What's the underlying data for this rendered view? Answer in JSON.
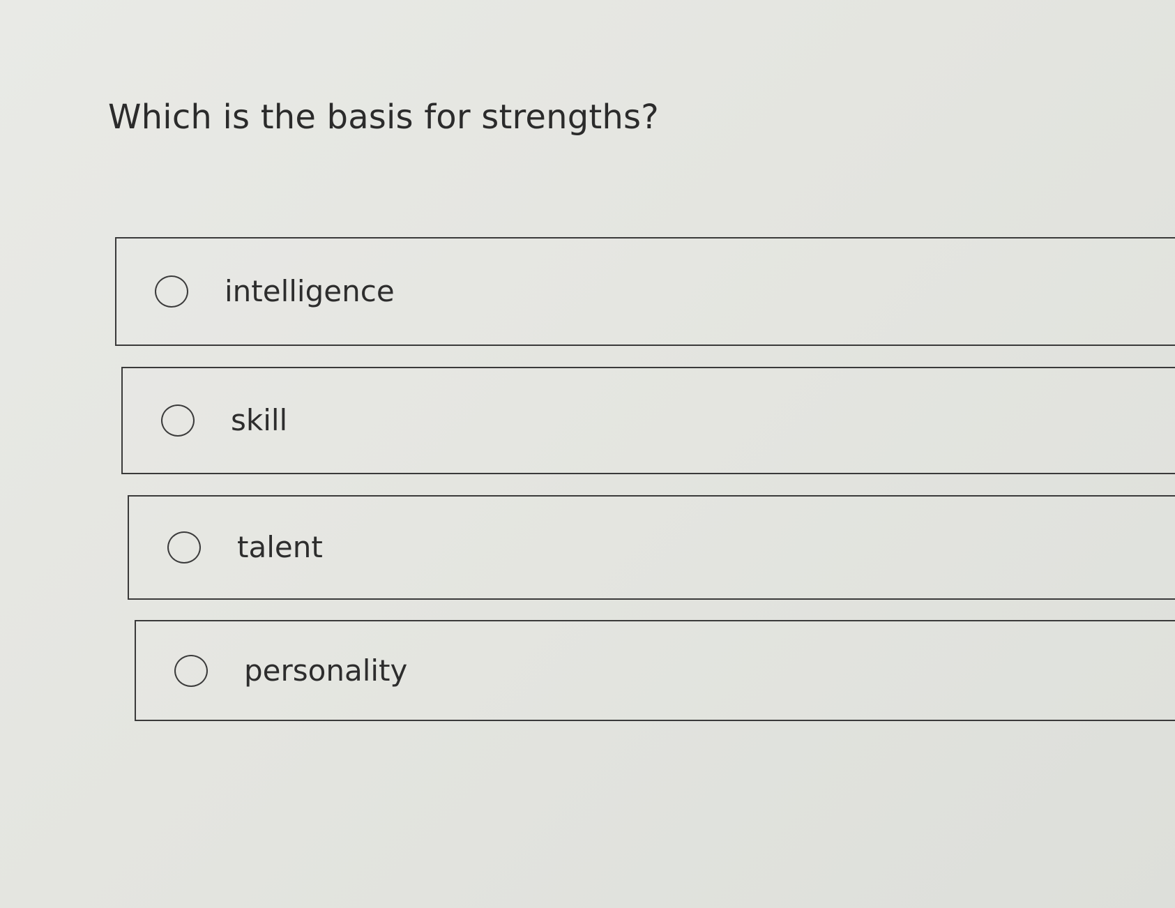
{
  "question": {
    "text": "Which is the basis for strengths?"
  },
  "options": [
    {
      "label": "intelligence",
      "selected": false
    },
    {
      "label": "skill",
      "selected": false
    },
    {
      "label": "talent",
      "selected": false
    },
    {
      "label": "personality",
      "selected": false
    }
  ]
}
